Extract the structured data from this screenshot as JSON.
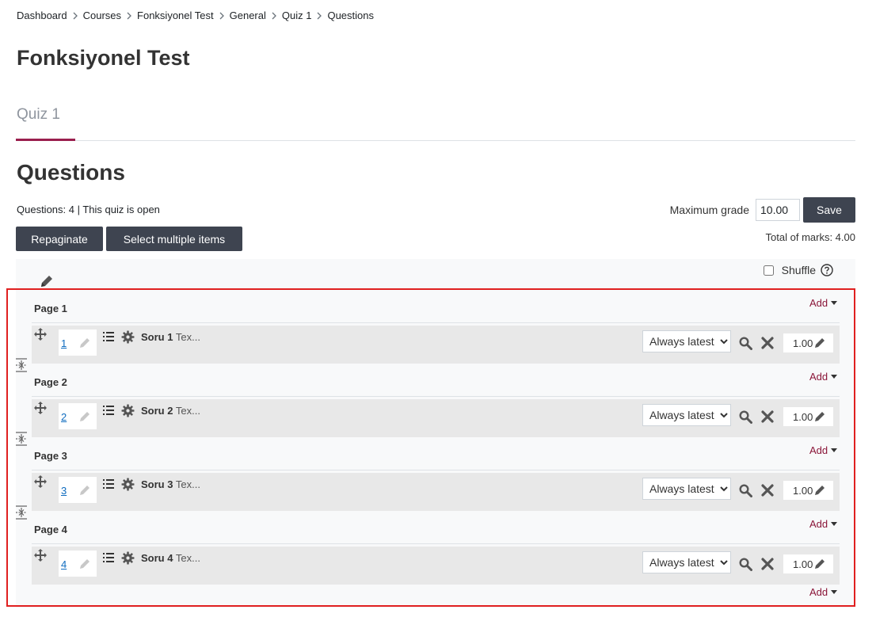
{
  "breadcrumb": [
    "Dashboard",
    "Courses",
    "Fonksiyonel Test",
    "General",
    "Quiz 1",
    "Questions"
  ],
  "course_title": "Fonksiyonel Test",
  "nav_tab": "Quiz 1",
  "section_title": "Questions",
  "status": "Questions: 4 | This quiz is open",
  "max_grade": {
    "label": "Maximum grade",
    "value": "10.00",
    "save_label": "Save"
  },
  "toolbar": {
    "repaginate_label": "Repaginate",
    "select_multiple_label": "Select multiple items"
  },
  "total_marks": "Total of marks: 4.00",
  "shuffle_label": "Shuffle",
  "add_label": "Add",
  "version_option": "Always latest",
  "pages": [
    {
      "label": "Page 1",
      "slot": {
        "number": "1",
        "name": "Soru 1",
        "text": "Tex...",
        "mark": "1.00"
      }
    },
    {
      "label": "Page 2",
      "slot": {
        "number": "2",
        "name": "Soru 2",
        "text": "Tex...",
        "mark": "1.00"
      }
    },
    {
      "label": "Page 3",
      "slot": {
        "number": "3",
        "name": "Soru 3",
        "text": "Tex...",
        "mark": "1.00"
      }
    },
    {
      "label": "Page 4",
      "slot": {
        "number": "4",
        "name": "Soru 4",
        "text": "Tex...",
        "mark": "1.00"
      }
    }
  ],
  "colors": {
    "button_dark": "#3e4450",
    "accent": "#9a1f4e",
    "link_add": "#8a1538",
    "link_number": "#0f6cbf",
    "highlight": "#e02020"
  }
}
